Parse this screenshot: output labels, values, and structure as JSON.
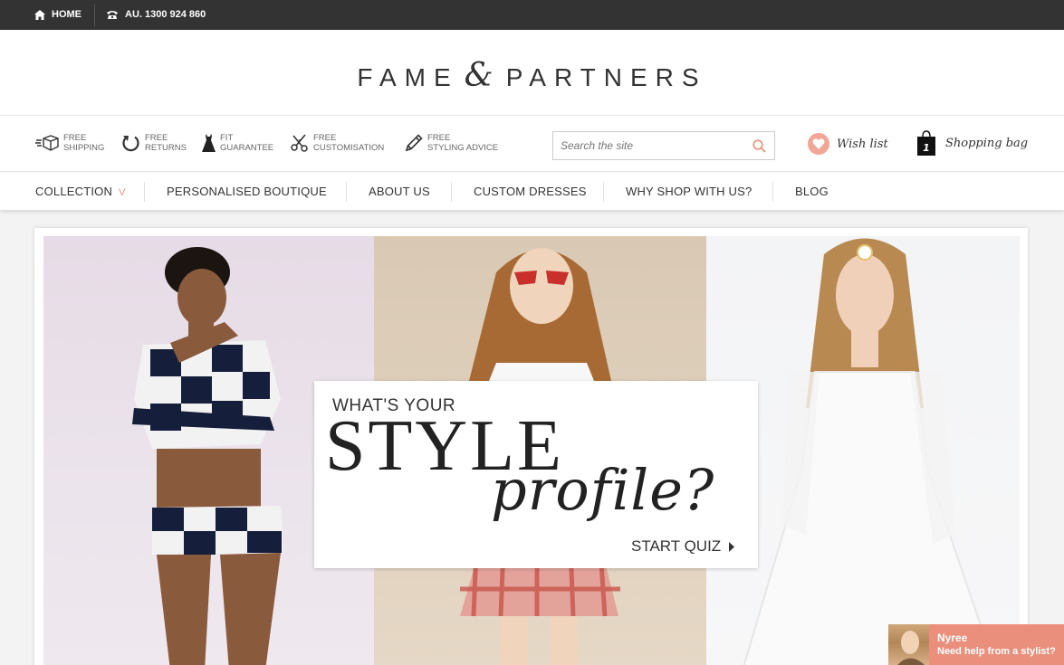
{
  "topbar": {
    "home_label": "HOME",
    "phone_label": "AU. 1300 924 860",
    "home_icon": "home-icon",
    "phone_icon": "phone-icon"
  },
  "brand": {
    "word1": "FAME",
    "amp": "&",
    "word2": "PARTNERS"
  },
  "features": [
    {
      "line1": "FREE",
      "line2": "SHIPPING",
      "icon": "shipping-box-icon"
    },
    {
      "line1": "FREE",
      "line2": "RETURNS",
      "icon": "returns-arrow-icon"
    },
    {
      "line1": "FIT",
      "line2": "GUARANTEE",
      "icon": "dress-icon"
    },
    {
      "line1": "FREE",
      "line2": "CUSTOMISATION",
      "icon": "scissors-icon"
    },
    {
      "line1": "FREE",
      "line2": "STYLING ADVICE",
      "icon": "pencil-icon"
    }
  ],
  "search": {
    "placeholder": "Search the site"
  },
  "wishlist": {
    "label": "Wish list"
  },
  "bag": {
    "label": "Shopping bag",
    "count": "1"
  },
  "nav": {
    "items": [
      {
        "label": "COLLECTION"
      },
      {
        "label": "PERSONALISED BOUTIQUE"
      },
      {
        "label": "ABOUT US"
      },
      {
        "label": "CUSTOM DRESSES"
      },
      {
        "label": "WHY SHOP WITH US?"
      },
      {
        "label": "BLOG"
      }
    ]
  },
  "hero": {
    "line1": "WHAT'S YOUR",
    "line2": "STYLE",
    "line3": "profile?",
    "cta": "START QUIZ"
  },
  "chat": {
    "name": "Nyree",
    "message": "Need help from a stylist?"
  },
  "colors": {
    "accent": "#ea8f7c",
    "topbar": "#333333",
    "heart": "#f1a696"
  }
}
